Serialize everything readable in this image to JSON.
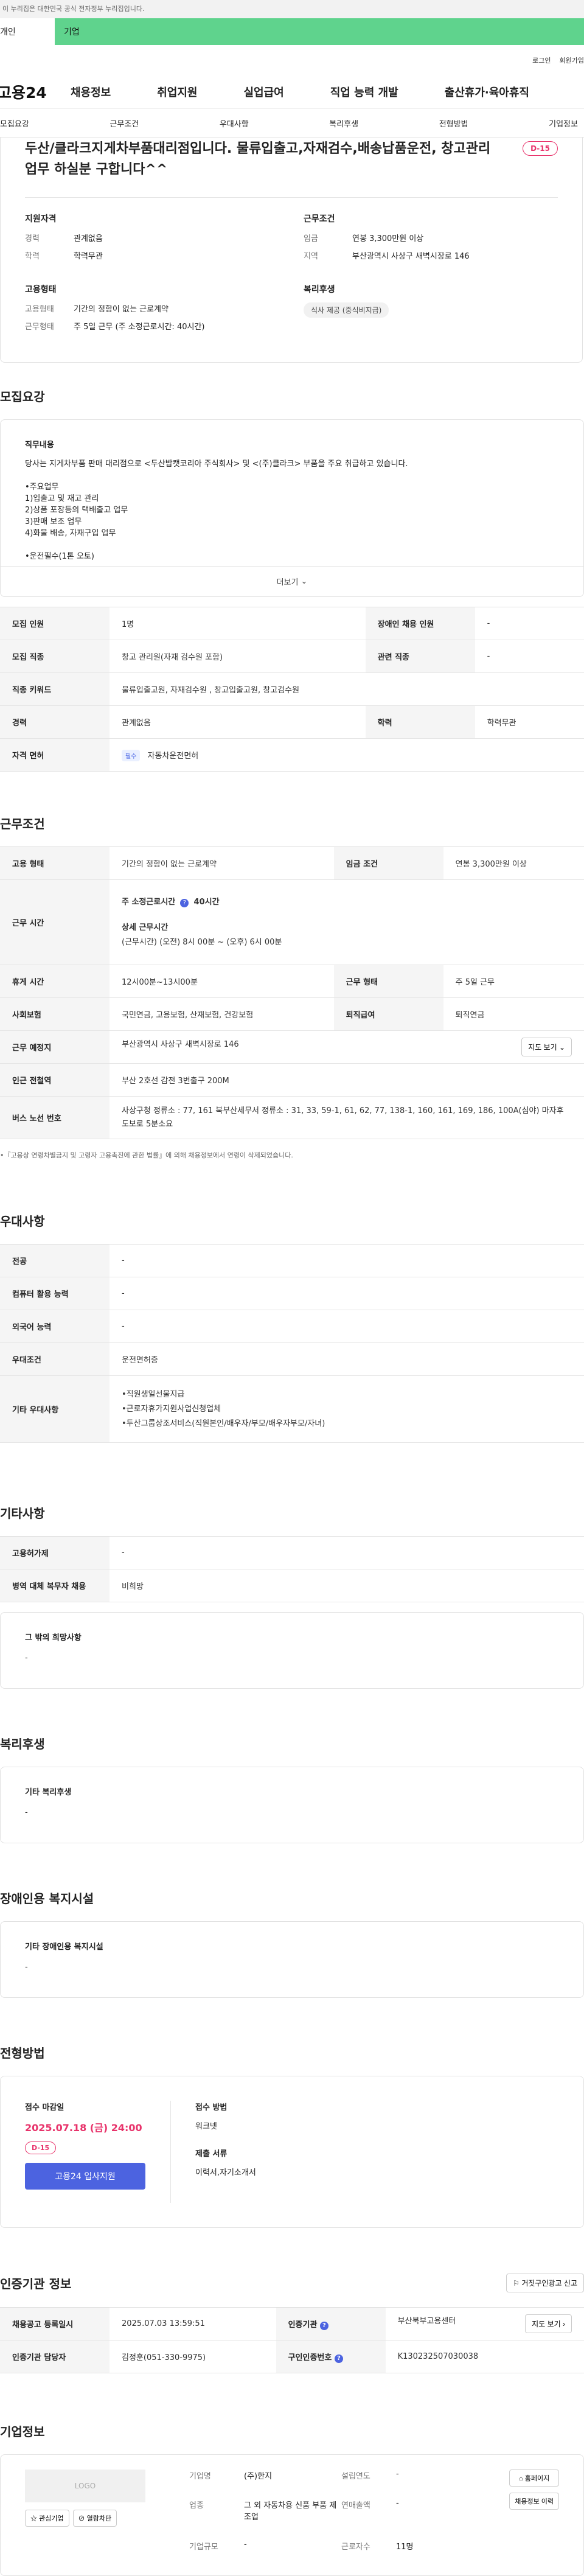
{
  "gov_banner": "이 누리집은 대한민국 공식 전자정부 누리집입니다.",
  "user_tabs": {
    "personal": "개인",
    "company": "기업"
  },
  "util": {
    "login": "로그인",
    "signup": "회원가입"
  },
  "logo": "고용24",
  "gnb": [
    "채용정보",
    "취업지원",
    "실업급여",
    "직업 능력 개발",
    "출산휴가·육아휴직"
  ],
  "subnav": [
    "모집요강",
    "근무조건",
    "우대사항",
    "복리후생",
    "전형방법",
    "기업정보"
  ],
  "job": {
    "title": "두산/클라크지게차부품대리점입니다. 물류입출고,자재검수,배송납품운전, 창고관리업무 하실분 구합니다^^",
    "dday": "D-15",
    "summary": {
      "qual_title": "지원자격",
      "career_k": "경력",
      "career_v": "관계없음",
      "edu_k": "학력",
      "edu_v": "학력무관",
      "cond_title": "근무조건",
      "wage_k": "임금",
      "wage_v": "연봉 3,300만원 이상",
      "region_k": "지역",
      "region_v": "부산광역시 사상구 새벽시장로 146",
      "emp_title": "고용형태",
      "emptype_k": "고용형태",
      "emptype_v": "기간의 정함이 없는 근로계약",
      "worktype_k": "근무형태",
      "worktype_v": "주 5일 근무 (주 소정근로시간: 40시간)",
      "welfare_title": "복리후생",
      "welfare_chip": "식사 제공 (중식비지급)"
    }
  },
  "recruit": {
    "title": "모집요강",
    "desc_heading": "직무내용",
    "desc_lines": [
      "당사는 지게차부품 판매 대리점으로 <두산밥캣코리아 주식회사> 및 <(주)클라크> 부품을 주요 취급하고 있습니다.",
      "",
      "•주요업무",
      "1)입출고 및 재고 관리",
      "2)상품 포장등의 택배출고 업무",
      "3)판매 보조 업무",
      "4)화물 배송, 자재구입 업무",
      "",
      "•운전필수(1톤 오토)"
    ],
    "more": "더보기",
    "rows": [
      {
        "k": "모집 인원",
        "v": "1명",
        "k2": "장애인 채용 인원",
        "v2": "-"
      },
      {
        "k": "모집 직종",
        "v": "창고 관리원(자재 검수원 포함)",
        "k2": "관련 직종",
        "v2": "-"
      },
      {
        "k": "직종 키워드",
        "v": "물류입출고원, 자재검수원 , 창고입출고원, 창고검수원"
      },
      {
        "k": "경력",
        "v": "관계없음",
        "k2": "학력",
        "v2": "학력무관"
      }
    ],
    "license_k": "자격 면허",
    "license_badge": "필수",
    "license_v": "자동차운전면허"
  },
  "conditions": {
    "title": "근무조건",
    "emptype_k": "고용 형태",
    "emptype_v": "기간의 정함이 없는 근로계약",
    "wage_k": "임금 조건",
    "wage_v": "연봉 3,300만원 이상",
    "hours_k": "근무 시간",
    "hours_line1a": "주 소정근로시간",
    "hours_line1b": "40시간",
    "hours_line2": "상세 근무시간",
    "hours_line3": "(근무시간) (오전) 8시 00분 ~ (오후) 6시 00분",
    "break_k": "휴게 시간",
    "break_v": "12시00분~13시00분",
    "workform_k": "근무 형태",
    "workform_v": "주 5일 근무",
    "insurance_k": "사회보험",
    "insurance_v": "국민연금, 고용보험, 산재보험, 건강보험",
    "severance_k": "퇴직급여",
    "severance_v": "퇴직연금",
    "location_k": "근무 예정지",
    "location_v": "부산광역시 사상구 새벽시장로 146",
    "map_btn": "지도 보기",
    "subway_k": "인근 전철역",
    "subway_v": "부산 2호선 감전 3번출구 200M",
    "bus_k": "버스 노선 번호",
    "bus_v": "사상구청 정류소 : 77, 161 북부산세무서 정류소 : 31, 33, 59-1, 61, 62, 77, 138-1, 160, 161, 169, 186, 100A(심야) 마자후 도보로 5분소요",
    "note": "•『고용상 연령차별금지 및 고령자 고용촉진에 관한 법률』에 의해 채용정보에서 연령이 삭제되었습니다."
  },
  "preference": {
    "title": "우대사항",
    "rows": [
      {
        "k": "전공",
        "v": "-"
      },
      {
        "k": "컴퓨터 활용 능력",
        "v": "-"
      },
      {
        "k": "외국어 능력",
        "v": "-"
      },
      {
        "k": "우대조건",
        "v": "운전면허증"
      }
    ],
    "other_k": "기타 우대사항",
    "other_lines": [
      "•직원생일선물지급",
      "•근로자휴가지원사업신청업체",
      "•두산그룹상조서비스(직원본인/배우자/부모/배우자부모/자녀)"
    ]
  },
  "etc": {
    "title": "기타사항",
    "rows": [
      {
        "k": "고용허가제",
        "v": "-"
      },
      {
        "k": "병역 대체 복무자 채용",
        "v": "비희망"
      }
    ],
    "box_h": "그 밖의 희망사항",
    "box_v": "-"
  },
  "welfare": {
    "title": "복리후생",
    "box_h": "기타 복리후생",
    "box_v": "-"
  },
  "disability": {
    "title": "장애인용 복지시설",
    "box_h": "기타 장애인용 복지시설",
    "box_v": "-"
  },
  "process": {
    "title": "전형방법",
    "deadline_h": "접수 마감일",
    "deadline_v": "2025.07.18 (금) 24:00",
    "dday": "D-15",
    "apply_btn": "고용24 입사지원",
    "method_h": "접수 방법",
    "method_v": "워크넷",
    "docs_h": "제출 서류",
    "docs_v": "이력서,자기소개서"
  },
  "cert": {
    "title": "인증기관 정보",
    "report_btn": "거짓구인광고 신고",
    "rows": [
      {
        "k": "채용공고 등록일시",
        "v": "2025.07.03 13:59:51",
        "k2": "인증기관",
        "v2": "부산북부고용센터",
        "btn": "지도 보기"
      },
      {
        "k": "인증기관 담당자",
        "v": "김정훈(051-330-9975)",
        "k2": "구인인증번호",
        "v2": "K130232507030038"
      }
    ]
  },
  "company": {
    "title": "기업정보",
    "logo_text": "LOGO",
    "interest_btn": "관심기업",
    "block_btn": "열람차단",
    "name_k": "기업명",
    "name_v": "(주)한지",
    "industry_k": "업종",
    "industry_v": "그 외 자동차용 신품 부품 제조업",
    "scale_k": "기업규모",
    "scale_v": "-",
    "founded_k": "설립연도",
    "founded_v": "-",
    "sales_k": "연매출액",
    "sales_v": "-",
    "employees_k": "근로자수",
    "employees_v": "11명",
    "homepage_btn": "홈페이지",
    "history_btn": "채용정보 이력"
  }
}
